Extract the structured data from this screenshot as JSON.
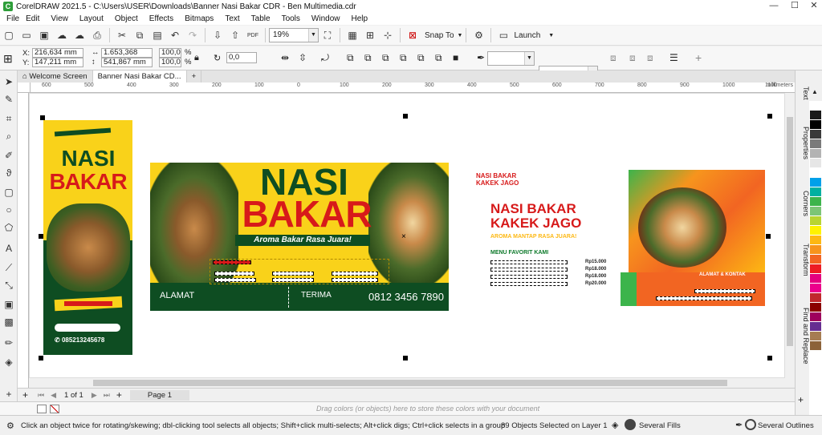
{
  "window": {
    "title": "CorelDRAW 2021.5 - C:\\Users\\USER\\Downloads\\Banner Nasi Bakar CDR - Ben Multimedia.cdr",
    "minimize": "—",
    "maximize": "☐",
    "close": "✕"
  },
  "menu": [
    "File",
    "Edit",
    "View",
    "Layout",
    "Object",
    "Effects",
    "Bitmaps",
    "Text",
    "Table",
    "Tools",
    "Window",
    "Help"
  ],
  "toolbar": {
    "zoom": "19%",
    "snap_to": "Snap To",
    "launch": "Launch"
  },
  "propbar": {
    "x_label": "X:",
    "x_value": "216,634 mm",
    "y_label": "Y:",
    "y_value": "147,211 mm",
    "w_value": "1.653,368 mm",
    "h_value": "541,867 mm",
    "scale_w": "100,0",
    "scale_h": "100,0",
    "pct": "%",
    "angle": "0,0",
    "deg": "°"
  },
  "tabs": [
    {
      "label": "Welcome Screen"
    },
    {
      "label": "Banner Nasi Bakar CD..."
    }
  ],
  "ruler": {
    "unit": "millimeters",
    "ticks": [
      "600",
      "500",
      "400",
      "300",
      "200",
      "100",
      "0",
      "100",
      "200",
      "300",
      "400",
      "500",
      "600",
      "700",
      "800",
      "900",
      "1000",
      "1100"
    ]
  },
  "banners": {
    "vertical": {
      "title1": "NASI",
      "title2": "BAKAR",
      "phone": "085213245678"
    },
    "horizontal": {
      "title1": "NASI",
      "title2": "BAKAR",
      "tagline": "Aroma Bakar Rasa Juara!",
      "address_label": "ALAMAT",
      "terima": "TERIMA",
      "phone": "0812 3456 7890"
    },
    "third": {
      "brand": "NASI BAKAR KAKEK JAGO",
      "title1": "NASI BAKAR",
      "title2": "KAKEK JAGO",
      "tagline": "AROMA MANTAP RASA JUARA!",
      "menu_label": "MENU FAVORIT KAMI",
      "address": "ALAMAT & KONTAK",
      "prices": [
        "Rp15.000",
        "Rp18.000",
        "Rp18.000",
        "Rp20.000"
      ]
    }
  },
  "pagebar": {
    "page_of": "1 of 1",
    "page_tab": "Page 1"
  },
  "palettebar": {
    "hint": "Drag colors (or objects) here to store these colors with your document"
  },
  "status": {
    "hint": "Click an object twice for rotating/skewing; dbl-clicking tool selects all objects; Shift+click multi-selects; Alt+click digs; Ctrl+click selects in a group",
    "selection": "89 Objects Selected on Layer 1",
    "fill": "Several Fills",
    "outline": "Several Outlines"
  },
  "dockers": [
    "Text",
    "Properties",
    "Corners",
    "Transform",
    "Find and Replace"
  ],
  "palette_colors": [
    "#ffffff",
    "#1a1a1a",
    "#000000",
    "#3a3a3a",
    "#7a7a7a",
    "#b3b3b3",
    "#e6e6e6",
    "#ffffff",
    "#00a0e9",
    "#00b0a0",
    "#3cb44b",
    "#7cc576",
    "#b8d432",
    "#fff200",
    "#fdb813",
    "#f7941d",
    "#f26522",
    "#ed1c24",
    "#e4007f",
    "#ec008c",
    "#c1272d",
    "#8b0000",
    "#9e005d",
    "#662d91",
    "#a67c52",
    "#8c6239"
  ]
}
